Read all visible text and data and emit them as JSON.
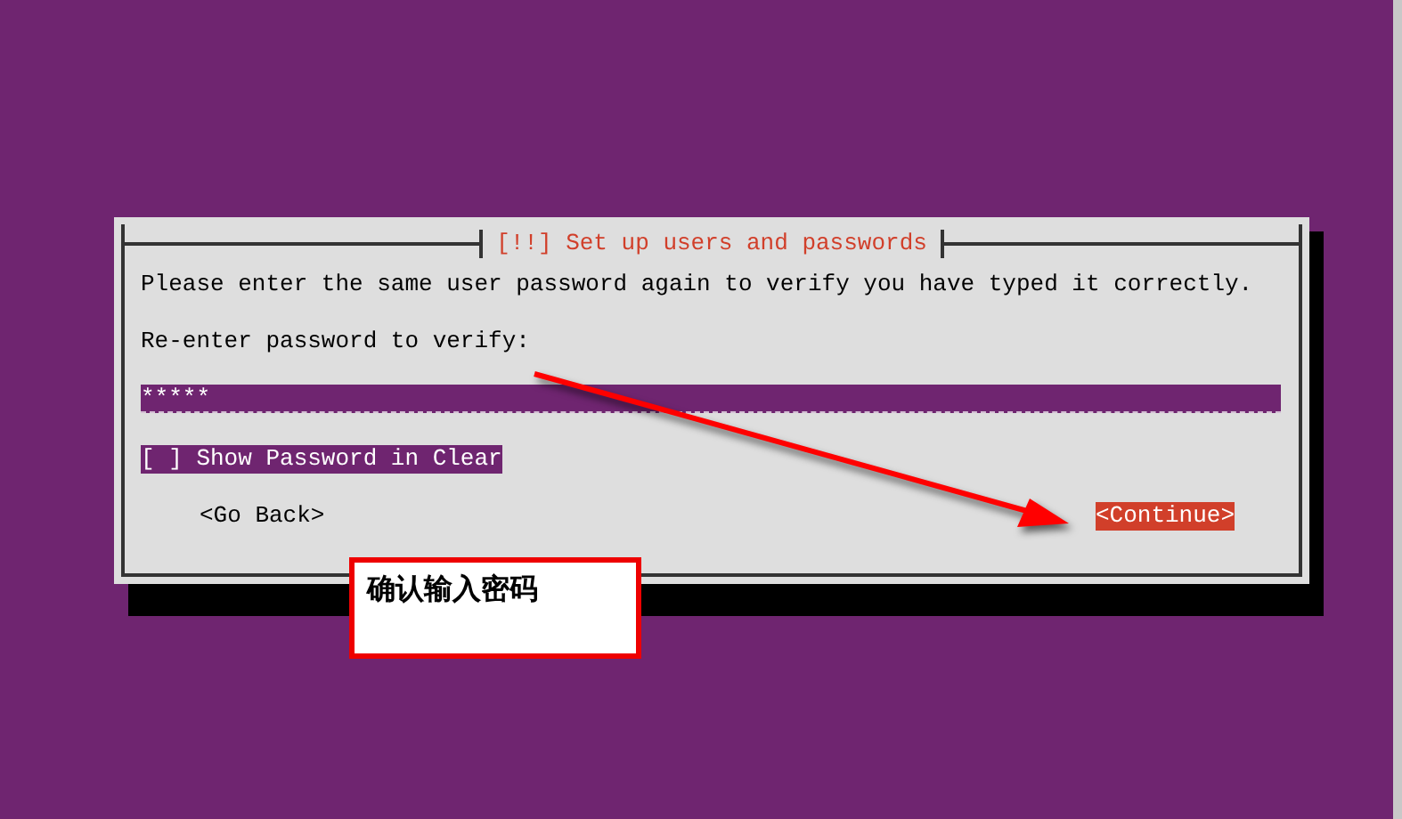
{
  "dialog": {
    "title": "[!!] Set up users and passwords",
    "instruction": "Please enter the same user password again to verify you have typed it correctly.",
    "prompt": "Re-enter password to verify:",
    "password_field": {
      "value": "*****"
    },
    "option": {
      "label": "[ ] Show Password in Clear",
      "selected": true
    },
    "buttons": [
      {
        "label": "<Go Back>",
        "selected": false
      },
      {
        "label": "<Continue>",
        "selected": true
      }
    ]
  },
  "annotation": {
    "text": "确认输入密码"
  }
}
